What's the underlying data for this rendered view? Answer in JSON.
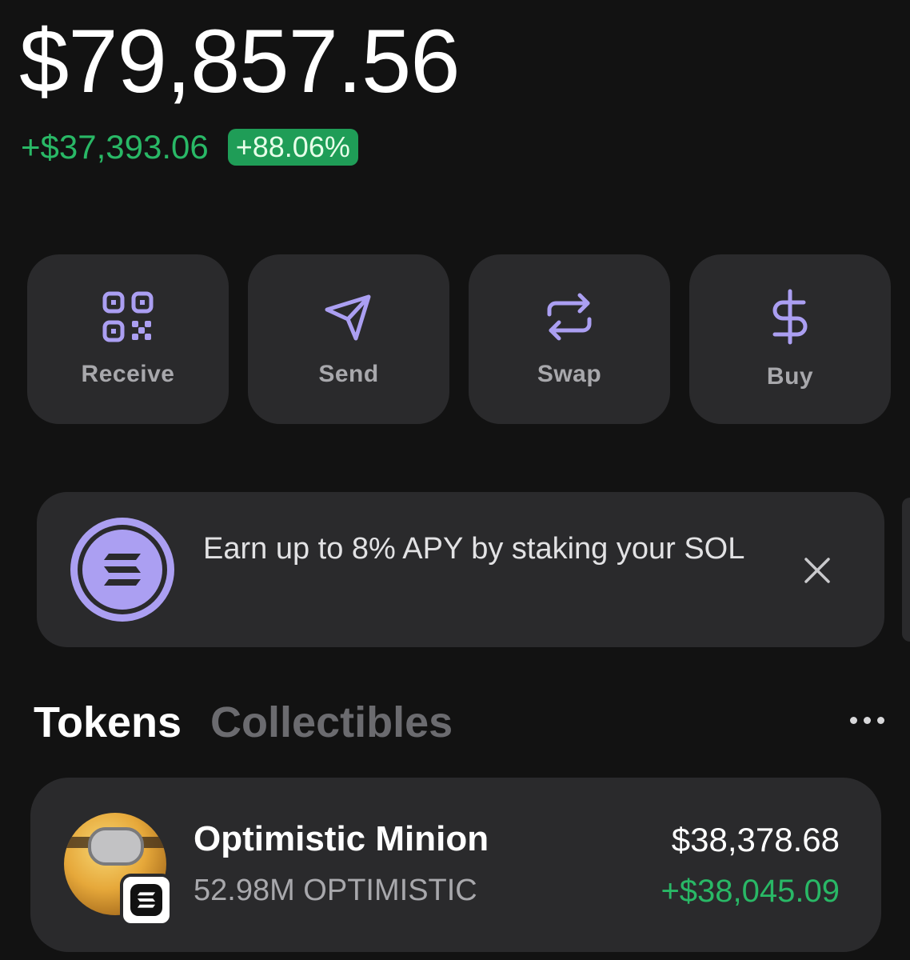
{
  "portfolio": {
    "balance": "$79,857.56",
    "change_amount": "+$37,393.06",
    "change_percent": "+88.06%"
  },
  "actions": [
    {
      "label": "Receive",
      "icon": "qr-code-icon"
    },
    {
      "label": "Send",
      "icon": "paper-plane-icon"
    },
    {
      "label": "Swap",
      "icon": "swap-arrows-icon"
    },
    {
      "label": "Buy",
      "icon": "dollar-icon"
    }
  ],
  "banner": {
    "text": "Earn up to 8% APY by staking your SOL",
    "icon": "solana-icon",
    "close_icon": "close-icon"
  },
  "tabs": {
    "tokens": "Tokens",
    "collectibles": "Collectibles",
    "more_icon": "more-horizontal-icon"
  },
  "tokens": [
    {
      "name": "Optimistic Minion",
      "amount": "52.98M OPTIMISTIC",
      "value": "$38,378.68",
      "change": "+$38,045.09"
    }
  ],
  "colors": {
    "background": "#121212",
    "card": "#2a2a2c",
    "accent": "#ab9ff2",
    "positive": "#29b866",
    "positive_pill": "#1f9d57"
  }
}
